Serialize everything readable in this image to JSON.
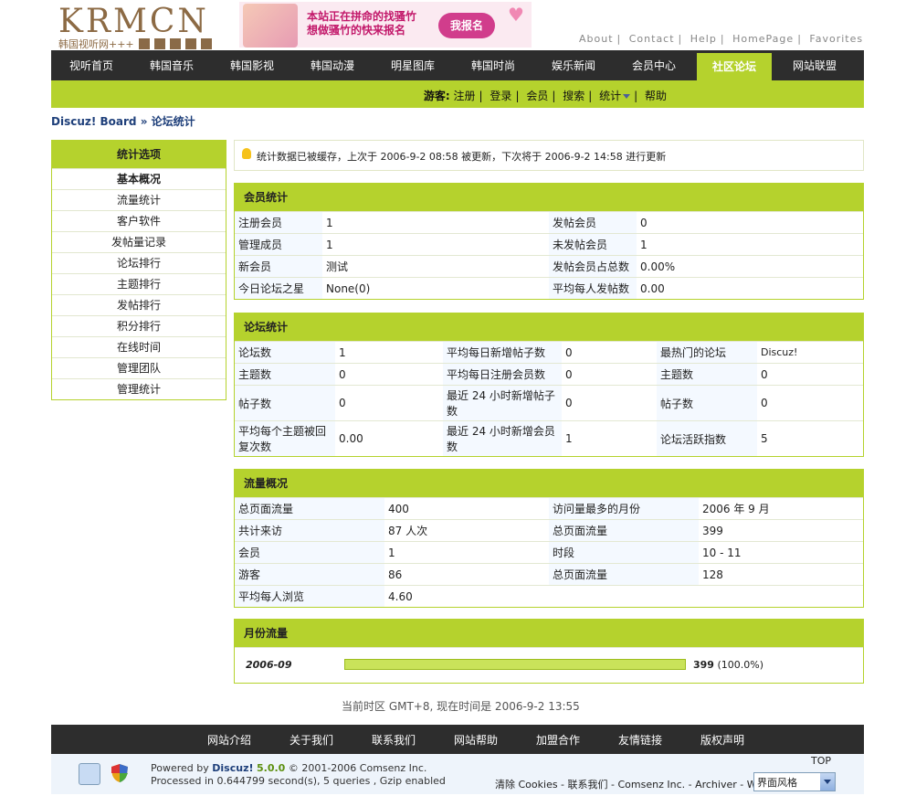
{
  "logo": {
    "text": "KRMCN",
    "sub": "韩国视听网+++"
  },
  "banner": {
    "line1": "本站正在拼命的找骚竹",
    "line2": "想做骚竹的快来报名",
    "button": "我报名"
  },
  "top_links": [
    "About",
    "Contact",
    "Help",
    "HomePage",
    "Favorites"
  ],
  "nav": [
    "视听首页",
    "韩国音乐",
    "韩国影视",
    "韩国动漫",
    "明星图库",
    "韩国时尚",
    "娱乐新闻",
    "会员中心",
    "社区论坛",
    "网站联盟"
  ],
  "nav_active": "社区论坛",
  "subnav": {
    "guest": "游客:",
    "links": [
      "注册",
      "登录",
      "会员",
      "搜索",
      "统计",
      "帮助"
    ]
  },
  "breadcrumb": {
    "board": "Discuz! Board",
    "sep": "»",
    "current": "论坛统计"
  },
  "sidebar": {
    "title": "统计选项",
    "items": [
      "基本概况",
      "流量统计",
      "客户软件",
      "发帖量记录",
      "论坛排行",
      "主题排行",
      "发帖排行",
      "积分排行",
      "在线时间",
      "管理团队",
      "管理统计"
    ]
  },
  "notice": "统计数据已被缓存，上次于 2006-9-2 08:58 被更新，下次将于 2006-9-2 14:58 进行更新",
  "member_stats": {
    "title": "会员统计",
    "rows": [
      [
        "注册会员",
        "1",
        "发帖会员",
        "0"
      ],
      [
        "管理成员",
        "1",
        "未发帖会员",
        "1"
      ],
      [
        "新会员",
        "测试",
        "发帖会员占总数",
        "0.00%"
      ],
      [
        "今日论坛之星",
        "None(0)",
        "平均每人发帖数",
        "0.00"
      ]
    ]
  },
  "forum_stats": {
    "title": "论坛统计",
    "rows": [
      [
        "论坛数",
        "1",
        "平均每日新增帖子数",
        "0",
        "最热门的论坛",
        "Discuz!"
      ],
      [
        "主题数",
        "0",
        "平均每日注册会员数",
        "0",
        "主题数",
        "0"
      ],
      [
        "帖子数",
        "0",
        "最近 24 小时新增帖子数",
        "0",
        "帖子数",
        "0"
      ],
      [
        "平均每个主题被回复次数",
        "0.00",
        "最近 24 小时新增会员数",
        "1",
        "论坛活跃指数",
        "5"
      ]
    ]
  },
  "traffic": {
    "title": "流量概况",
    "rows": [
      [
        "总页面流量",
        "400",
        "访问量最多的月份",
        "2006 年 9 月"
      ],
      [
        "共计来访",
        "87 人次",
        "总页面流量",
        "399"
      ],
      [
        "会员",
        "1",
        "时段",
        "10 - 11"
      ],
      [
        "游客",
        "86",
        "总页面流量",
        "128"
      ],
      [
        "平均每人浏览",
        "4.60",
        "",
        ""
      ]
    ]
  },
  "monthly": {
    "title": "月份流量",
    "month": "2006-09",
    "value": "399",
    "percent": "(100.0%)",
    "fill": 1.0
  },
  "timezone": "当前时区 GMT+8, 现在时间是 2006-9-2 13:55",
  "footer_nav": [
    "网站介绍",
    "关于我们",
    "联系我们",
    "网站帮助",
    "加盟合作",
    "友情链接",
    "版权声明"
  ],
  "powered": {
    "prefix": "Powered by",
    "product": "Discuz!",
    "version": "5.0.0",
    "copyright": "© 2001-2006 Comsenz Inc.",
    "processed": "Processed in 0.644799 second(s), 5 queries , Gzip enabled"
  },
  "footer_links": "清除 Cookies - 联系我们 - Comsenz Inc. - Archiver - WAP",
  "top_label": "TOP",
  "style_select": "界面风格",
  "colors": {
    "accent": "#b5d22d",
    "nav_bg": "#2d2d2d",
    "link": "#1e3f7a"
  }
}
